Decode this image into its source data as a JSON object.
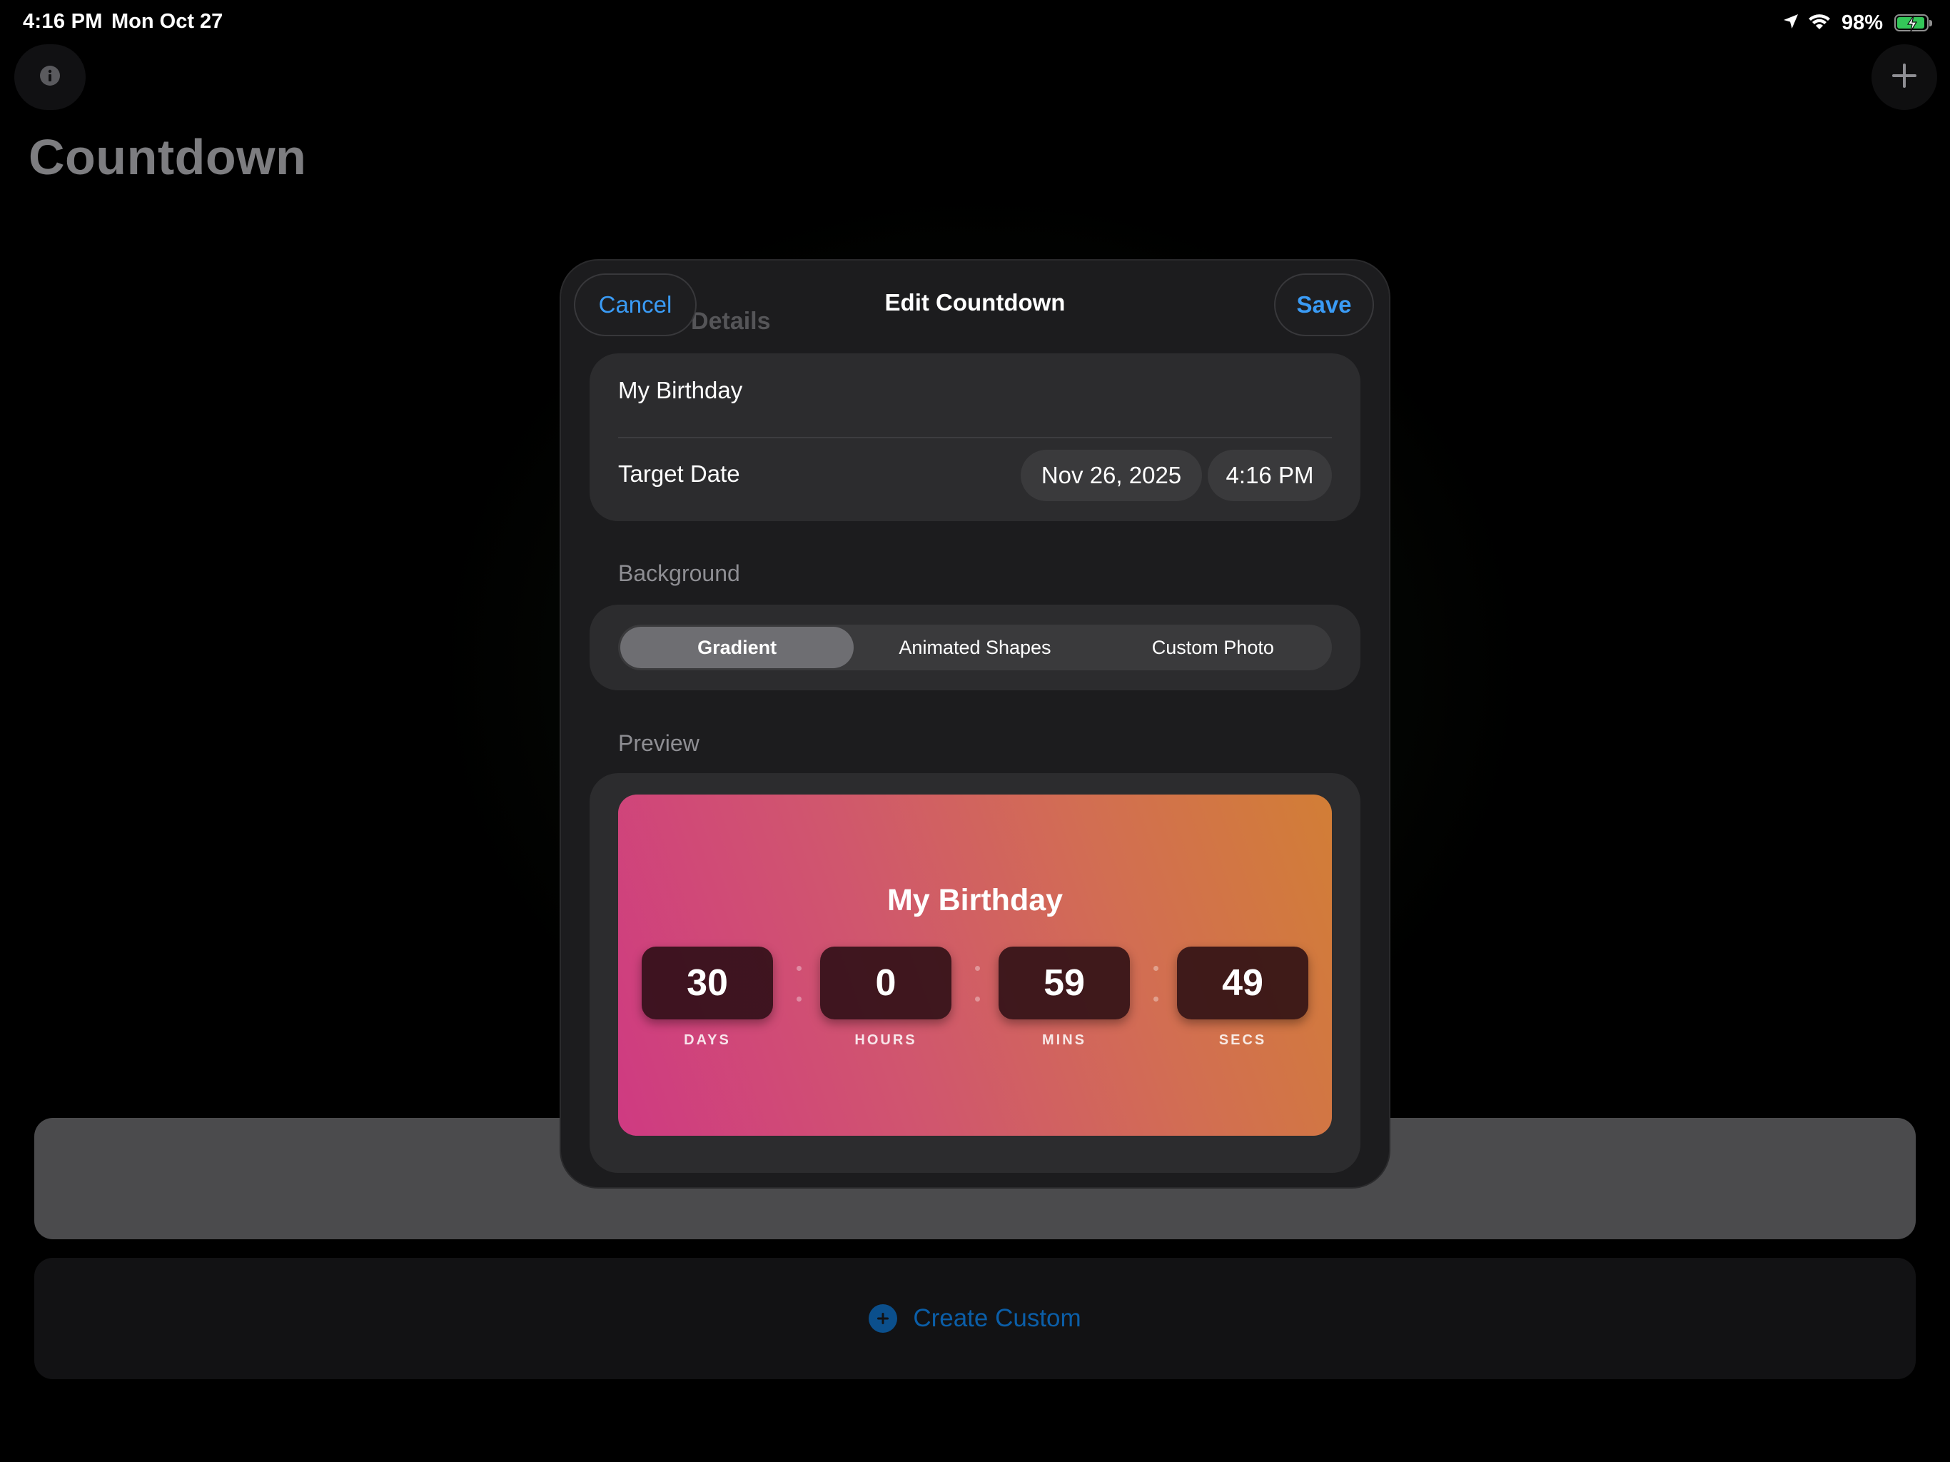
{
  "status_bar": {
    "time": "4:16 PM",
    "date": "Mon Oct 27",
    "battery_pct": "98%",
    "battery_level": 0.98,
    "icons": [
      "location-arrow-icon",
      "wifi-icon",
      "battery-charging-icon"
    ]
  },
  "app": {
    "title": "Countdown",
    "info_icon": "info-icon",
    "add_icon": "plus-icon",
    "create_custom_label": "Create Custom",
    "create_custom_icon": "plus-circle-icon"
  },
  "modal": {
    "title": "Edit Countdown",
    "cancel_label": "Cancel",
    "save_label": "Save",
    "ghost_header": "Event Details",
    "name_value": "My Birthday",
    "target_date_label": "Target Date",
    "date_value": "Nov 26, 2025",
    "time_value": "4:16 PM",
    "background_label": "Background",
    "segments": [
      "Gradient",
      "Animated Shapes",
      "Custom Photo"
    ],
    "selected_segment": "Gradient",
    "preview_label": "Preview"
  },
  "preview": {
    "title": "My Birthday",
    "units": [
      {
        "value": "30",
        "label": "DAYS"
      },
      {
        "value": "0",
        "label": "HOURS"
      },
      {
        "value": "59",
        "label": "MINS"
      },
      {
        "value": "49",
        "label": "SECS"
      }
    ]
  },
  "colors": {
    "accent": "#3a9bf5",
    "gradient_start": "#cf3a82",
    "gradient_end": "#d27e36",
    "battery_green": "#34c759"
  }
}
